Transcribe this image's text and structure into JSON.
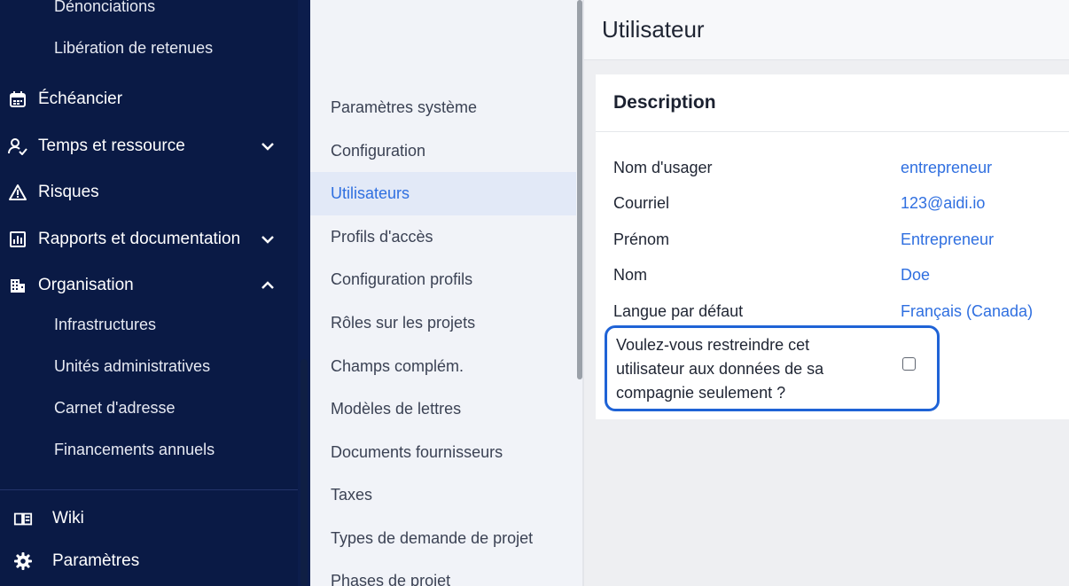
{
  "sidebar": {
    "sub_top": [
      "Dénonciations",
      "Libération de retenues"
    ],
    "items": [
      {
        "label": "Échéancier",
        "icon": "calendar-icon"
      },
      {
        "label": "Temps et ressource",
        "icon": "user-check-icon",
        "expanded": false
      },
      {
        "label": "Risques",
        "icon": "warning-icon"
      },
      {
        "label": "Rapports et documentation",
        "icon": "report-icon",
        "expanded": false
      },
      {
        "label": "Organisation",
        "icon": "building-icon",
        "expanded": true
      }
    ],
    "org_sub": [
      "Infrastructures",
      "Unités administratives",
      "Carnet d'adresse",
      "Financements annuels"
    ],
    "bottom": [
      {
        "label": "Wiki",
        "icon": "book-icon"
      },
      {
        "label": "Paramètres",
        "icon": "gear-icon"
      }
    ]
  },
  "menu": {
    "active": "Utilisateurs",
    "items": [
      "Paramètres système",
      "Configuration",
      "Utilisateurs",
      "Profils d'accès",
      "Configuration profils",
      "Rôles sur les projets",
      "Champs complém.",
      "Modèles de lettres",
      "Documents fournisseurs",
      "Taxes",
      "Types de demande de projet",
      "Phases de projet"
    ]
  },
  "page": {
    "title": "Utilisateur",
    "section_title": "Description",
    "fields": [
      {
        "label": "Nom d'usager",
        "value": "entrepreneur"
      },
      {
        "label": "Courriel",
        "value": "123@aidi.io"
      },
      {
        "label": "Prénom",
        "value": "Entrepreneur"
      },
      {
        "label": "Nom",
        "value": "Doe"
      },
      {
        "label": "Langue par défaut",
        "value": "Français (Canada)"
      }
    ],
    "restrict_label": "Voulez-vous restreindre cet utilisateur aux données de sa compagnie seulement ?",
    "restrict_checked": false
  },
  "colors": {
    "sidebar_bg": "#0a1a45",
    "accent": "#2f6fe0",
    "highlight_border": "#1f63d6"
  }
}
